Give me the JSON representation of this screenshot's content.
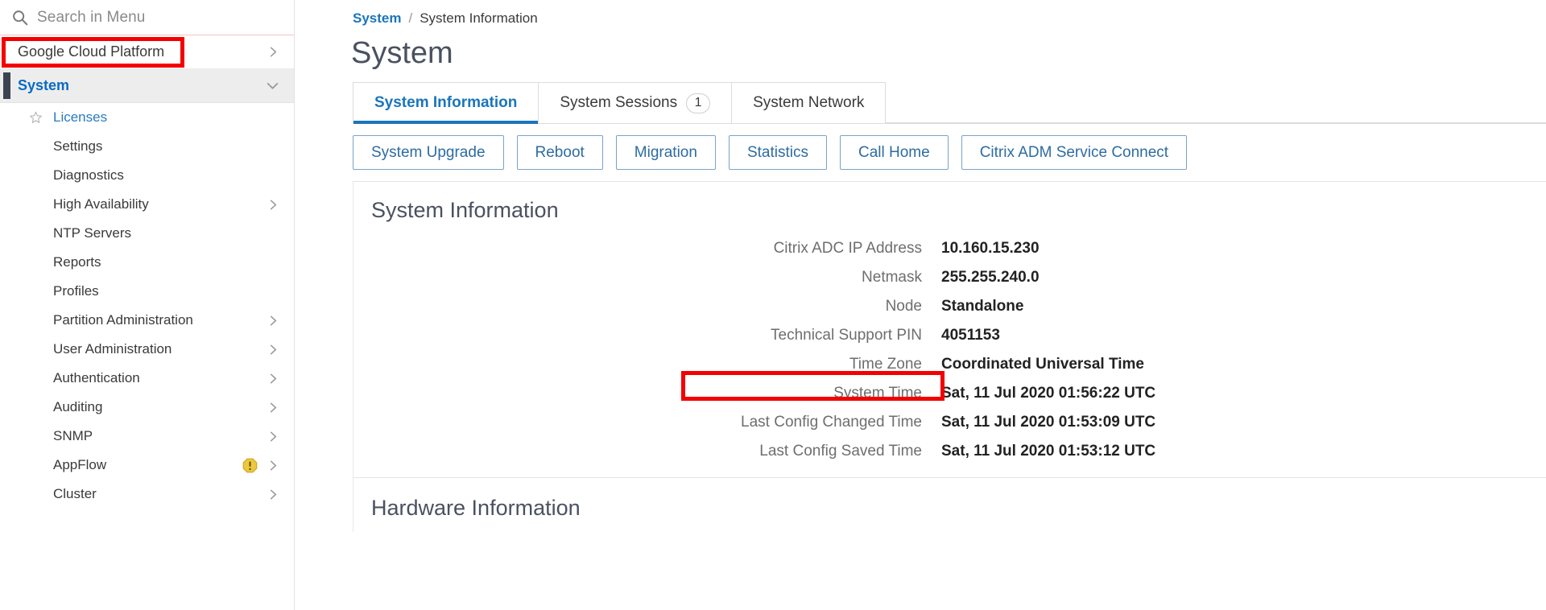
{
  "sidebar": {
    "search": {
      "placeholder": "Search in Menu",
      "value": "",
      "icon": "search-icon"
    },
    "top_items": [
      {
        "label": "Google Cloud Platform",
        "chevron": "chevron-right-icon",
        "highlighted": true
      }
    ],
    "group": {
      "label": "System",
      "chevron": "chevron-down-icon",
      "expanded": true
    },
    "items": [
      {
        "label": "Licenses",
        "star": true,
        "chevron": false,
        "link": true
      },
      {
        "label": "Settings",
        "star": false,
        "chevron": false,
        "link": false
      },
      {
        "label": "Diagnostics",
        "star": false,
        "chevron": false,
        "link": false
      },
      {
        "label": "High Availability",
        "star": false,
        "chevron": true,
        "link": false
      },
      {
        "label": "NTP Servers",
        "star": false,
        "chevron": false,
        "link": false
      },
      {
        "label": "Reports",
        "star": false,
        "chevron": false,
        "link": false
      },
      {
        "label": "Profiles",
        "star": false,
        "chevron": false,
        "link": false
      },
      {
        "label": "Partition Administration",
        "star": false,
        "chevron": true,
        "link": false
      },
      {
        "label": "User Administration",
        "star": false,
        "chevron": true,
        "link": false
      },
      {
        "label": "Authentication",
        "star": false,
        "chevron": true,
        "link": false
      },
      {
        "label": "Auditing",
        "star": false,
        "chevron": true,
        "link": false
      },
      {
        "label": "SNMP",
        "star": false,
        "chevron": true,
        "link": false
      },
      {
        "label": "AppFlow",
        "star": false,
        "chevron": true,
        "link": false,
        "warning": true
      },
      {
        "label": "Cluster",
        "star": false,
        "chevron": true,
        "link": false
      }
    ]
  },
  "breadcrumb": {
    "root": "System",
    "separator": "/",
    "current": "System Information"
  },
  "page": {
    "title": "System"
  },
  "tabs": [
    {
      "label": "System Information",
      "badge": null,
      "active": true
    },
    {
      "label": "System Sessions",
      "badge": "1",
      "active": false
    },
    {
      "label": "System Network",
      "badge": null,
      "active": false
    }
  ],
  "toolbar": {
    "buttons": [
      "System Upgrade",
      "Reboot",
      "Migration",
      "Statistics",
      "Call Home",
      "Citrix ADM Service Connect"
    ]
  },
  "system_information": {
    "heading": "System Information",
    "rows": [
      {
        "label": "Citrix ADC IP Address",
        "value": "10.160.15.230"
      },
      {
        "label": "Netmask",
        "value": "255.255.240.0"
      },
      {
        "label": "Node",
        "value": "Standalone"
      },
      {
        "label": "Technical Support PIN",
        "value": "4051153",
        "highlighted": true
      },
      {
        "label": "Time Zone",
        "value": "Coordinated Universal Time"
      },
      {
        "label": "System Time",
        "value": "Sat, 11 Jul 2020 01:56:22 UTC"
      },
      {
        "label": "Last Config Changed Time",
        "value": "Sat, 11 Jul 2020 01:53:09 UTC"
      },
      {
        "label": "Last Config Saved Time",
        "value": "Sat, 11 Jul 2020 01:53:12 UTC"
      }
    ]
  },
  "hardware_information": {
    "heading": "Hardware Information"
  },
  "colors": {
    "accent_blue": "#1b75bb",
    "link_blue": "#2a7ac0",
    "title_gray": "#4a5160",
    "highlight_red": "#f40000",
    "warning_yellow": "#e8c02e",
    "group_bg": "#ededed",
    "group_accent": "#3c4350"
  }
}
